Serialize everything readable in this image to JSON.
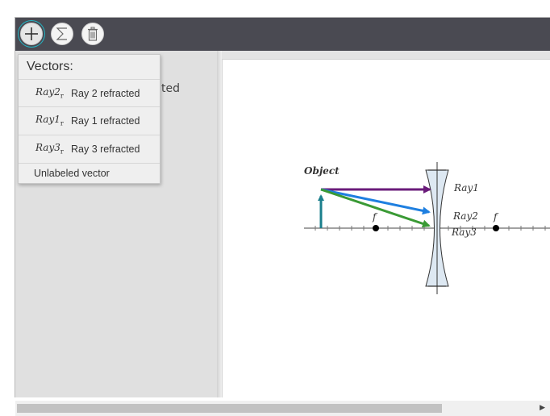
{
  "toolbar": {
    "buttons": [
      {
        "name": "add-button",
        "icon": "plus-icon",
        "active": true
      },
      {
        "name": "sum-button",
        "icon": "sigma-icon"
      },
      {
        "name": "delete-button",
        "icon": "trash-icon"
      }
    ]
  },
  "algebra": {
    "partial_text": "ted"
  },
  "vectors_menu": {
    "title": "Vectors:",
    "items": [
      {
        "math_name": "Ray2",
        "math_sub": "r",
        "description": "Ray 2 refracted"
      },
      {
        "math_name": "Ray1",
        "math_sub": "r",
        "description": "Ray 1 refracted"
      },
      {
        "math_name": "Ray3",
        "math_sub": "r",
        "description": "Ray 3 refracted"
      }
    ],
    "unlabeled": "Unlabeled vector"
  },
  "graphics": {
    "object_label": "Object",
    "ray1_label": "Ray1",
    "ray2_label": "Ray2",
    "ray3_label": "Ray3",
    "focal_left_label": "f",
    "focal_right_label": "f"
  },
  "colors": {
    "toolbar_bg": "#4a4a52",
    "accent": "#23b5c4",
    "object_arrow": "#1b7f8c",
    "ray1": "#6a1b7a",
    "ray2": "#1e7fe0",
    "ray3": "#3a9a35",
    "lens_fill": "#dde8f2"
  }
}
